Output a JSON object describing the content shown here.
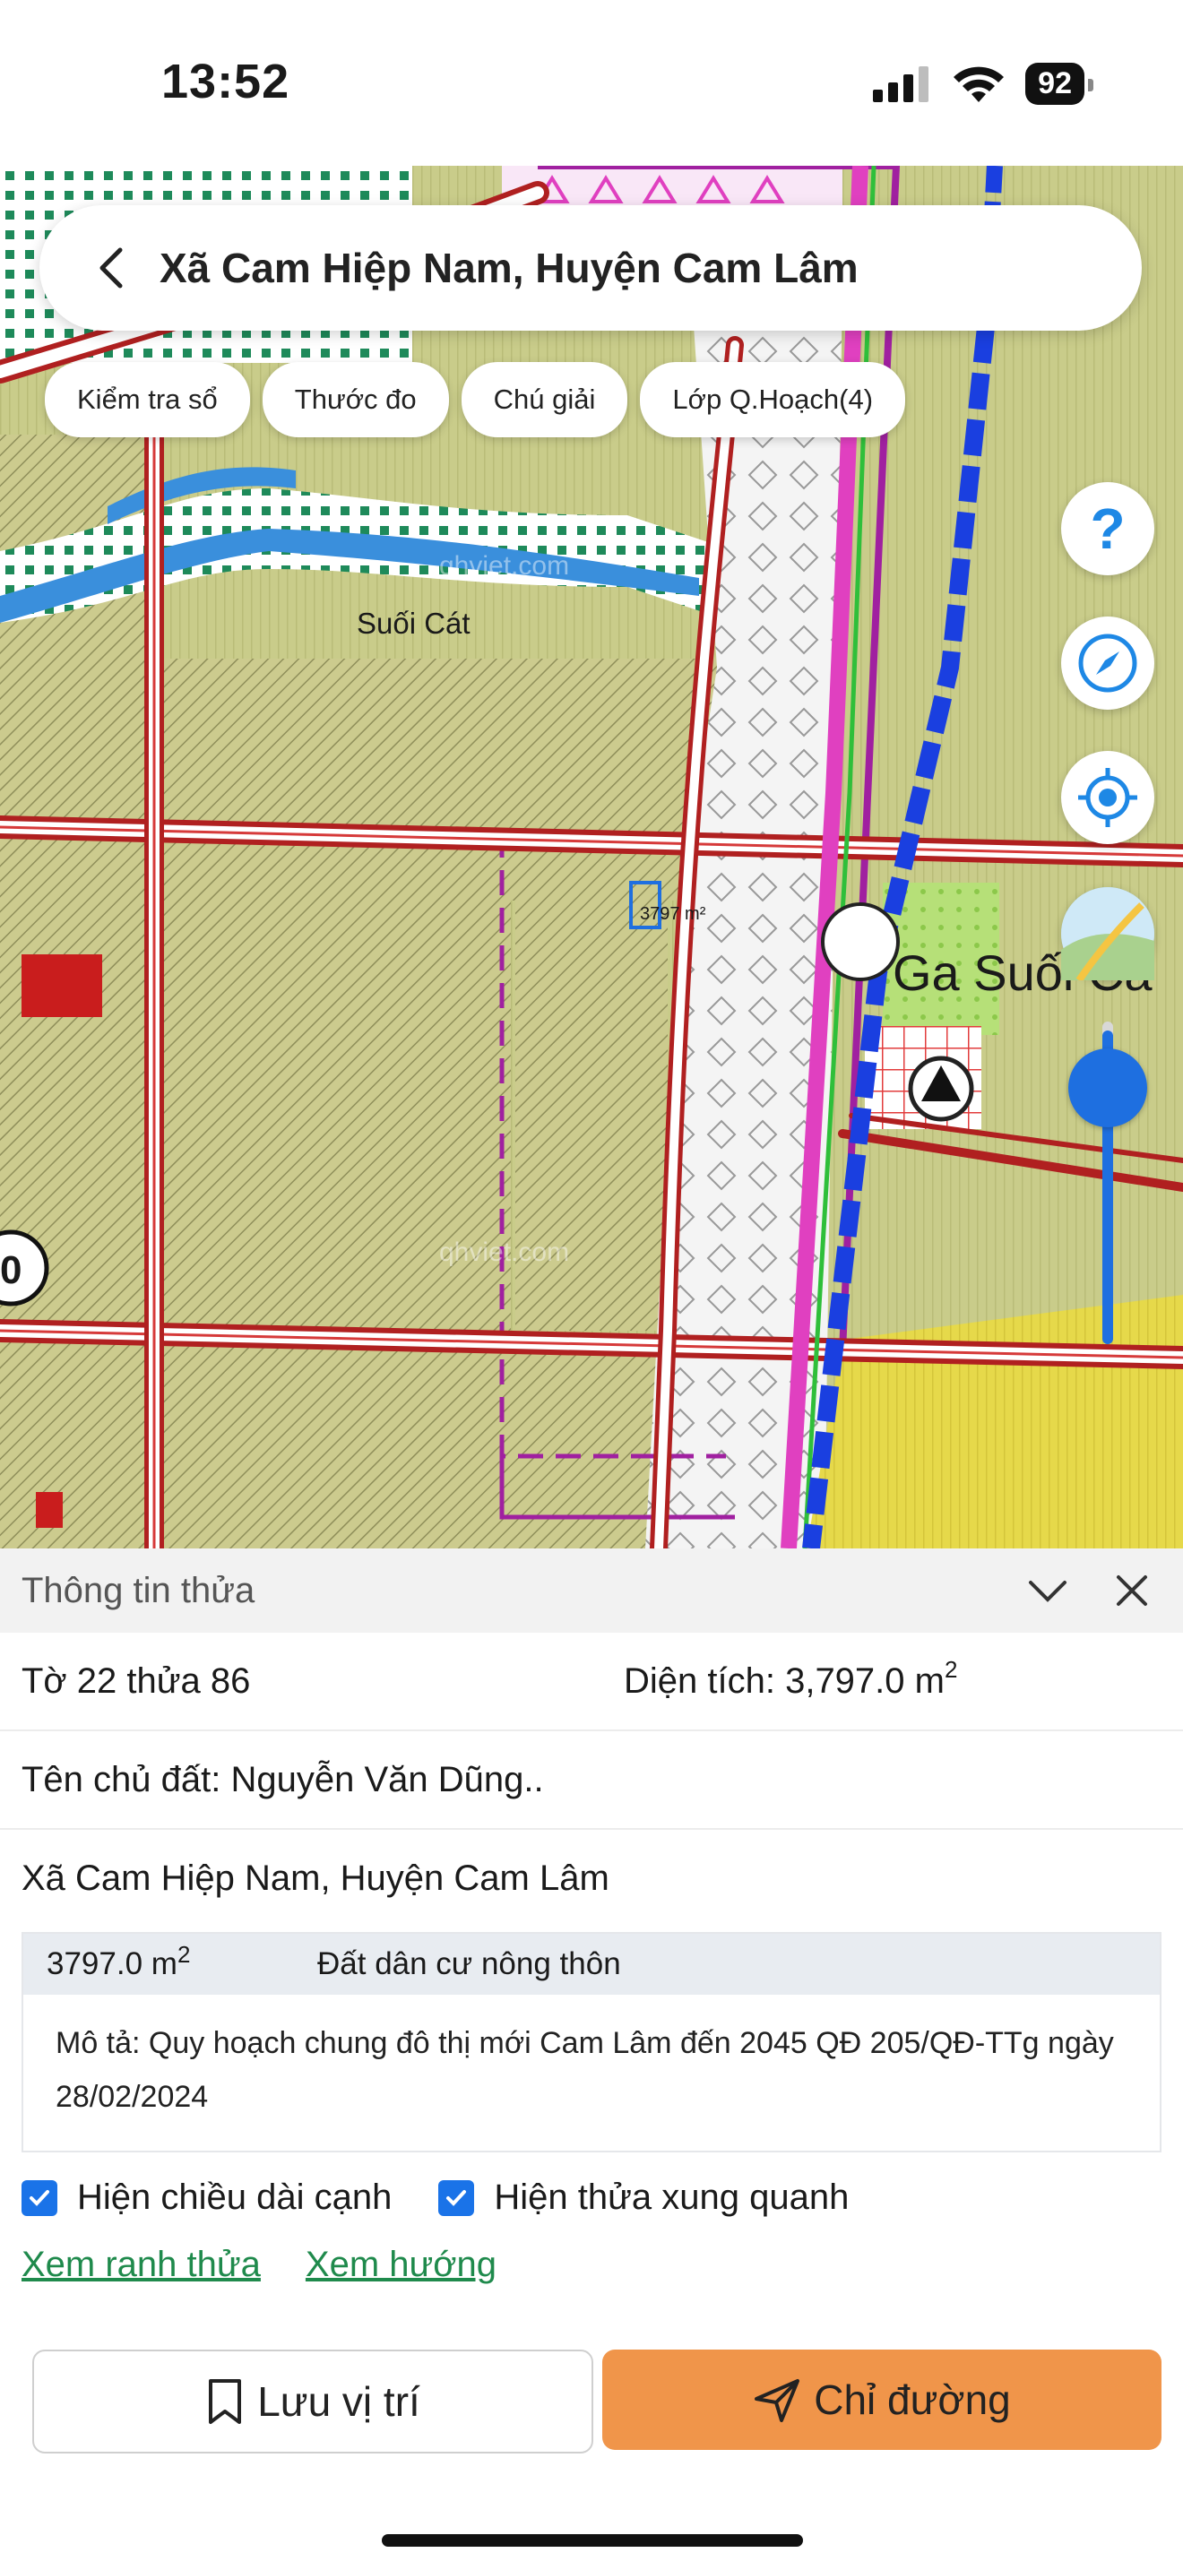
{
  "status": {
    "time": "13:52",
    "battery": "92"
  },
  "search": {
    "title": "Xã Cam Hiệp Nam, Huyện Cam Lâm"
  },
  "chips": [
    "Kiểm tra sổ",
    "Thước đo",
    "Chú giải",
    "Lớp Q.Hoạch(4)"
  ],
  "map": {
    "river_label": "Suối Cát",
    "watermark": "qhviet.com",
    "parcel_label": "3797 m²",
    "station_label": "Ga Suối Cá",
    "edge_number": "0",
    "colors": {
      "residential": "#c8c98a",
      "river": "#3a8fdc",
      "road": "#c0392b",
      "planning_boundary": "#a020a0",
      "rail": "#1a3fe0",
      "commercial": "#e4d84a",
      "green": "#a6d86a"
    }
  },
  "panel": {
    "title": "Thông tin thửa",
    "sheet_parcel": "Tờ 22 thửa 86",
    "area_label": "Diện tích: 3,797.0 m",
    "area_sup": "2",
    "owner": "Tên chủ đất: Nguyễn Văn Dũng..",
    "address": "Xã Cam Hiệp Nam, Huyện Cam Lâm",
    "zone_area": "3797.0 m",
    "zone_area_sup": "2",
    "zone_type": "Đất dân cư nông thôn",
    "description": "Mô tả: Quy hoạch chung đô thị mới Cam Lâm đến 2045 QĐ 205/QĐ-TTg ngày 28/02/2024",
    "check_edges": "Hiện chiều dài cạnh",
    "check_neighbors": "Hiện thửa xung quanh",
    "link_bounds": "Xem ranh thửa",
    "link_direction": "Xem hướng",
    "btn_save": "Lưu vị trí",
    "btn_directions": "Chỉ đường"
  }
}
